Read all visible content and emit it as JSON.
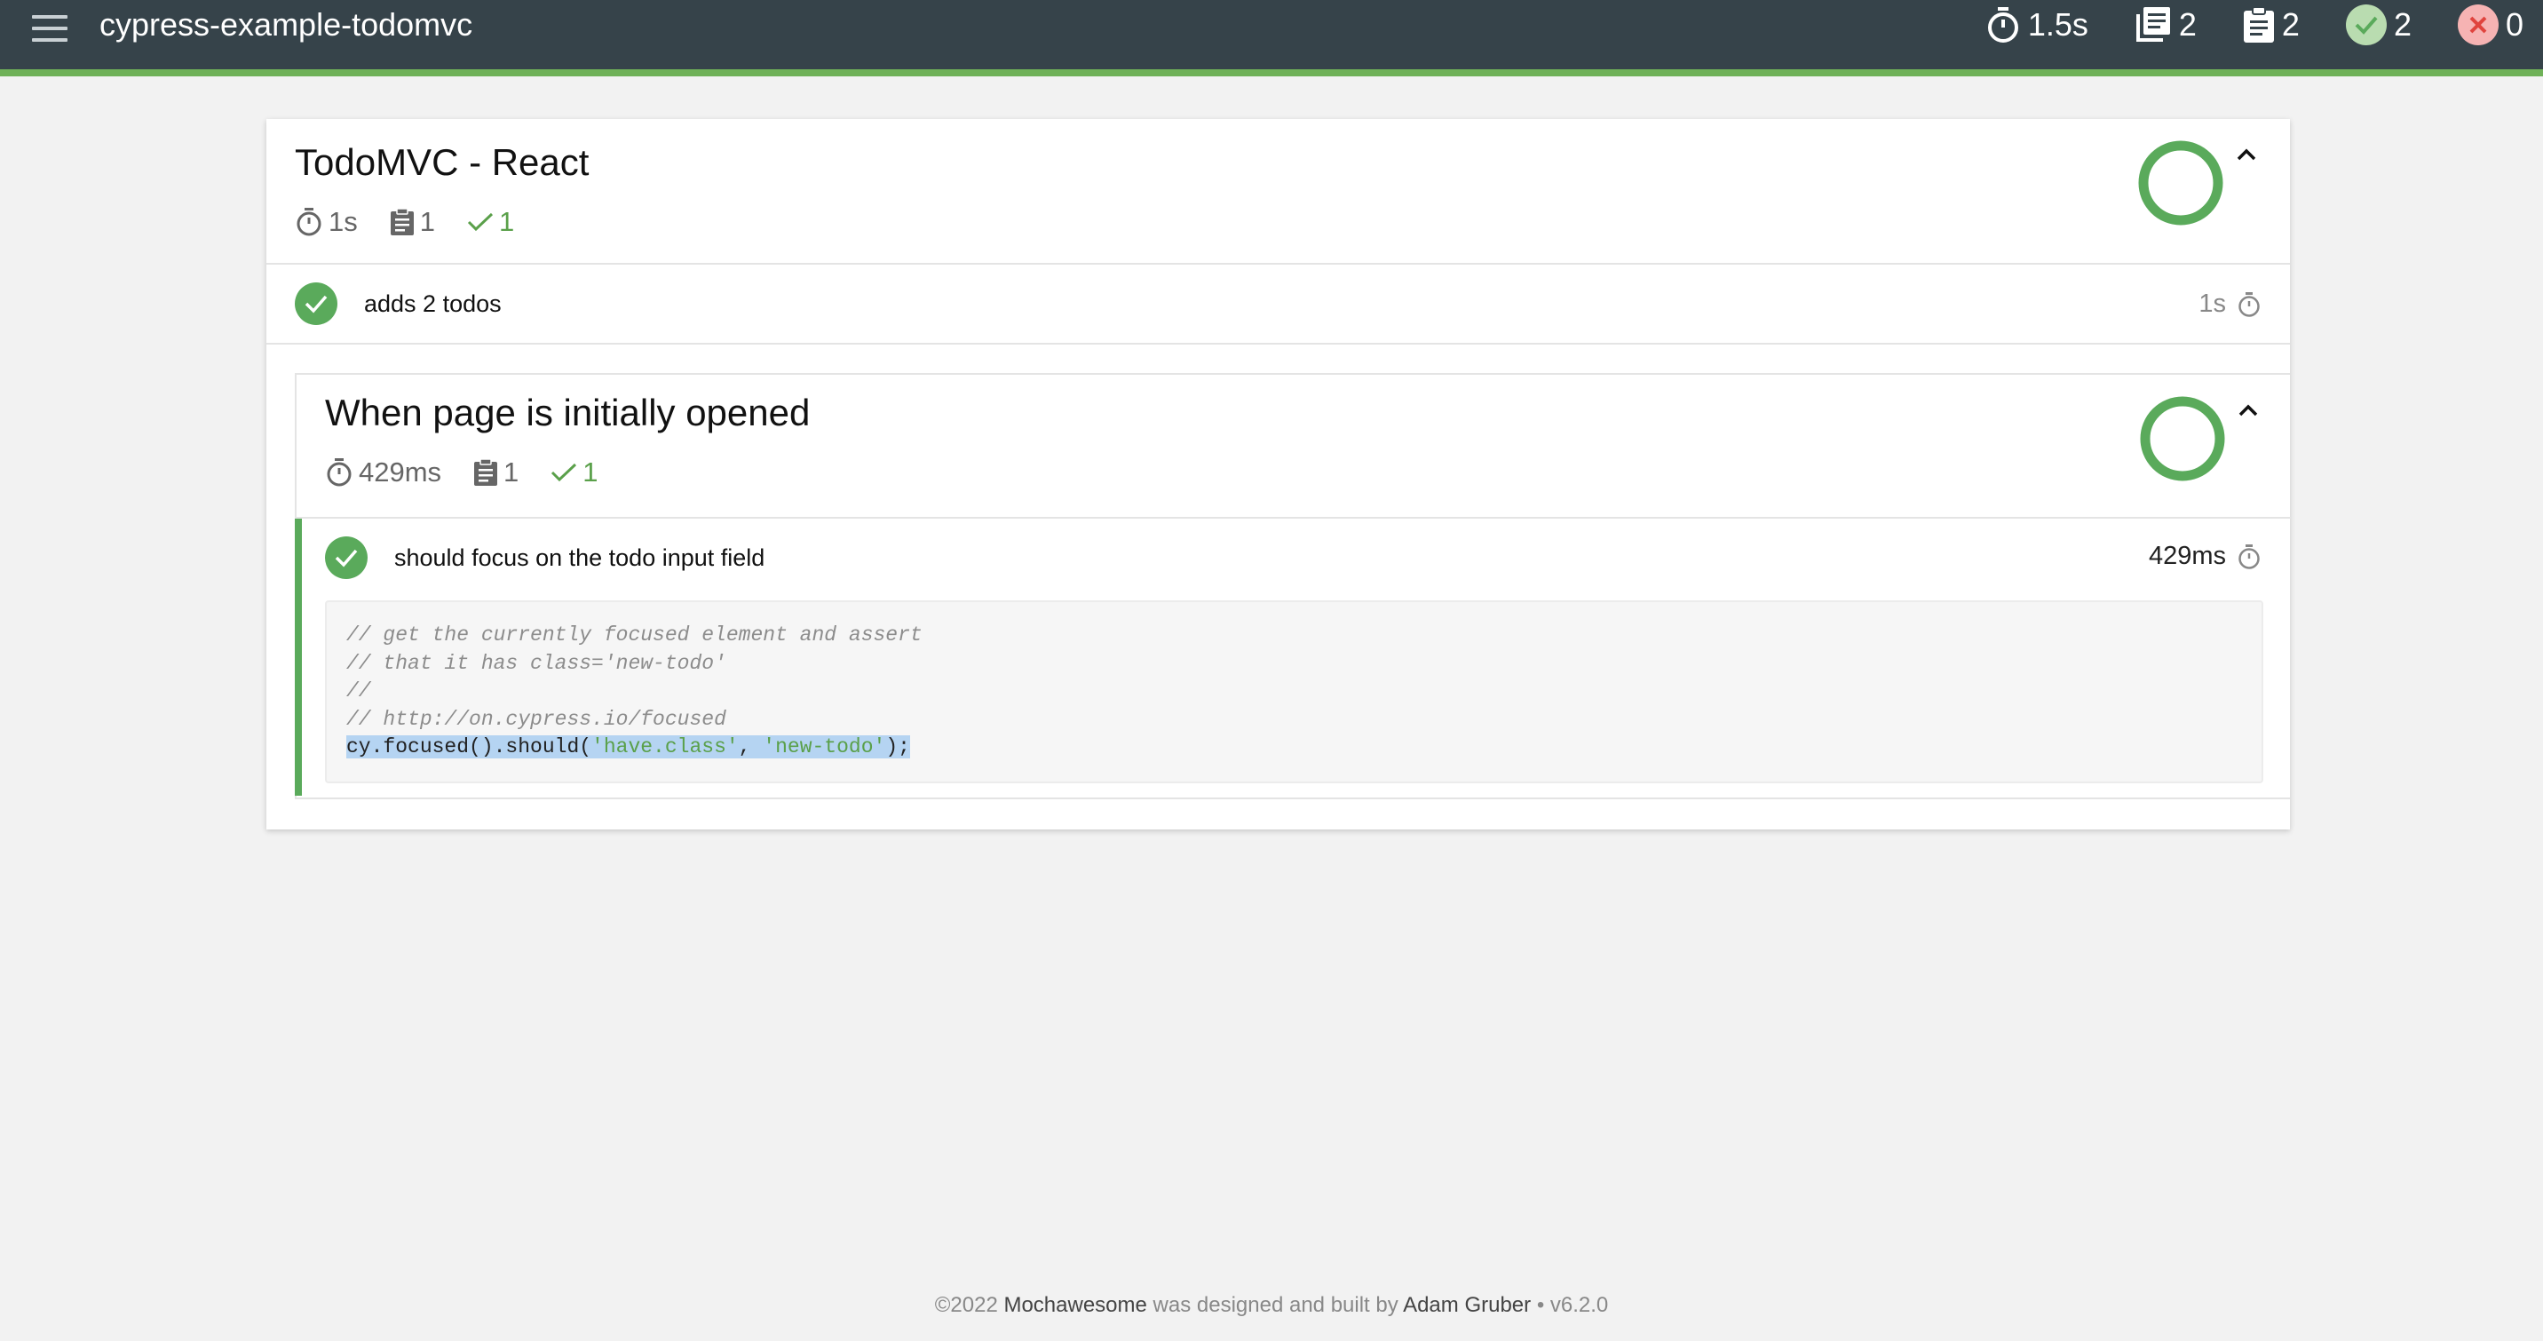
{
  "navbar": {
    "title": "cypress-example-todomvc",
    "duration": "1.5s",
    "suites": "2",
    "tests": "2",
    "passes": "2",
    "failures": "0"
  },
  "suite": {
    "title": "TodoMVC - React",
    "duration": "1s",
    "tests": "1",
    "passes": "1",
    "test": {
      "title": "adds 2 todos",
      "duration": "1s"
    }
  },
  "inner_suite": {
    "title": "When page is initially opened",
    "duration": "429ms",
    "tests": "1",
    "passes": "1",
    "test": {
      "title": "should focus on the todo input field",
      "duration": "429ms"
    },
    "code": {
      "comments": [
        "// get the currently focused element and assert",
        "// that it has class='new-todo'",
        "//",
        "// http://on.cypress.io/focused"
      ],
      "line_prefix": "cy.focused().should(",
      "arg1": "'have.class'",
      "sep": ", ",
      "arg2": "'new-todo'",
      "line_suffix": ");"
    }
  },
  "footer": {
    "copyright": "©2022",
    "product": "Mochawesome",
    "middle": "was designed and built by",
    "author": "Adam Gruber",
    "version": "• v6.2.0"
  },
  "colors": {
    "navbar": "#36434a",
    "accent": "#6fb158",
    "pass": "#5aaa5b",
    "fail": "#f6b3b3"
  }
}
